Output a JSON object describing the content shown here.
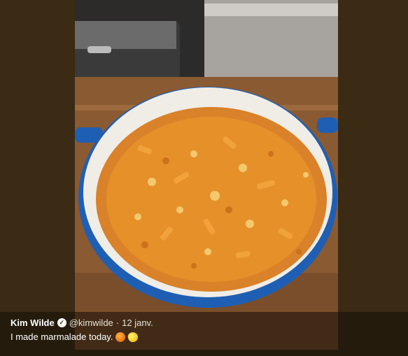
{
  "tweet": {
    "author": "Kim Wilde",
    "verified_icon": "verified-badge-icon",
    "handle": "@kimwilde",
    "separator": "·",
    "date": "12 janv.",
    "text": "I made marmalade today.",
    "emojis": [
      "tangerine-emoji-icon",
      "lemon-emoji-icon"
    ]
  },
  "colors": {
    "background": "#3b2a14",
    "pot_blue": "#1f5fb3",
    "marmalade": "#e6902a"
  }
}
